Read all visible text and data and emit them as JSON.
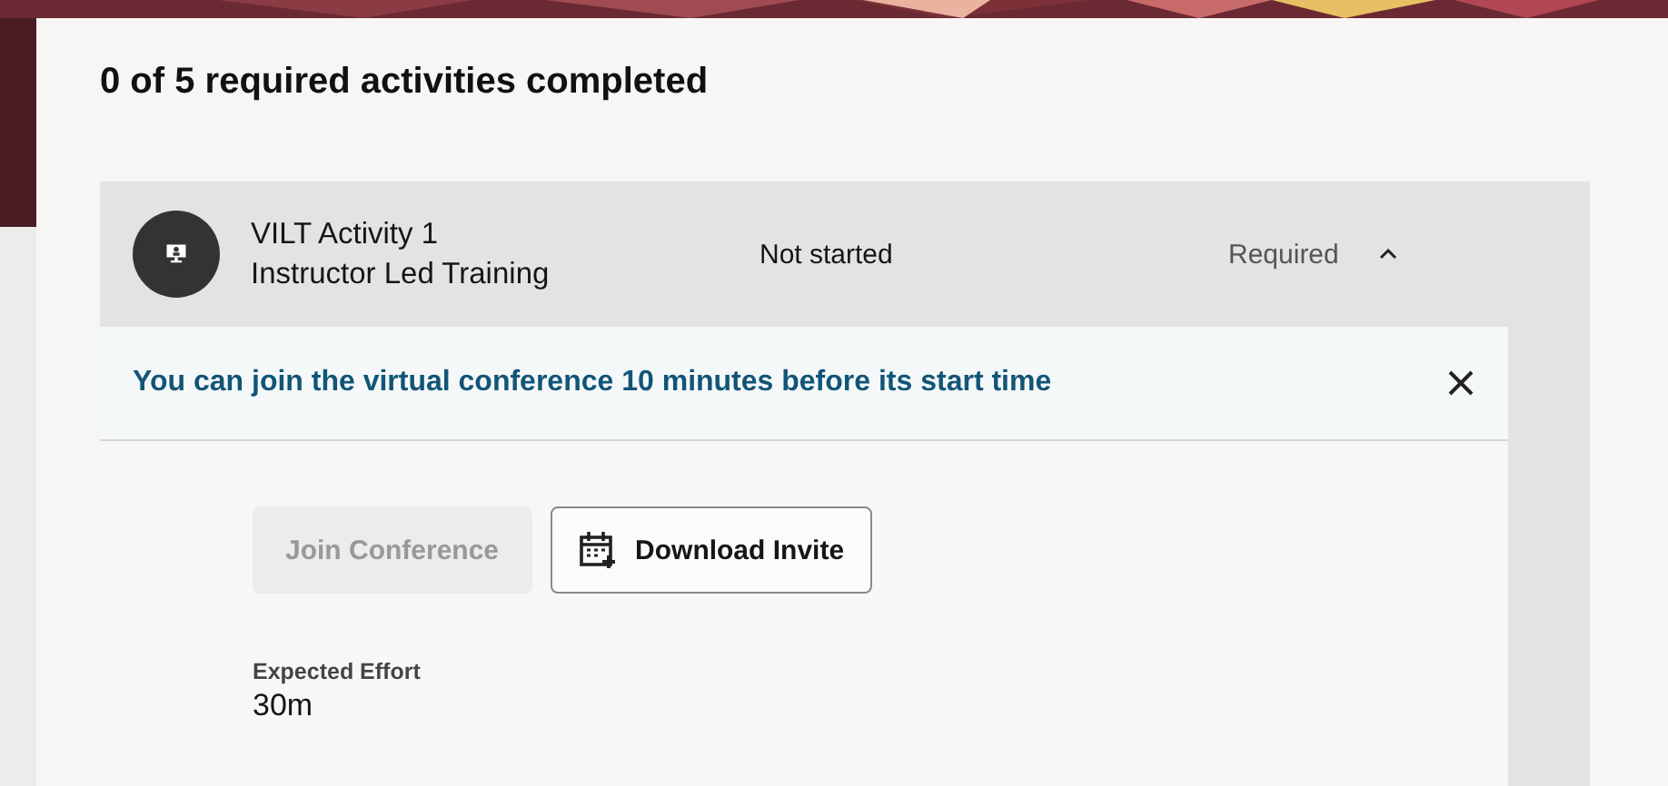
{
  "progress": {
    "title": "0 of 5 required activities completed"
  },
  "activity": {
    "title": "VILT Activity 1",
    "subtitle": "Instructor Led Training",
    "status": "Not started",
    "requirement": "Required",
    "expanded": true
  },
  "notice": {
    "text": "You can join the virtual conference 10 minutes before its start time",
    "dismissible": true
  },
  "buttons": [
    {
      "label": "Join Conference",
      "disabled": true,
      "kind": "plain"
    },
    {
      "label": "Download Invite",
      "disabled": false,
      "kind": "calendar"
    }
  ],
  "details": [
    {
      "label": "Expected Effort",
      "value": "30m"
    }
  ]
}
